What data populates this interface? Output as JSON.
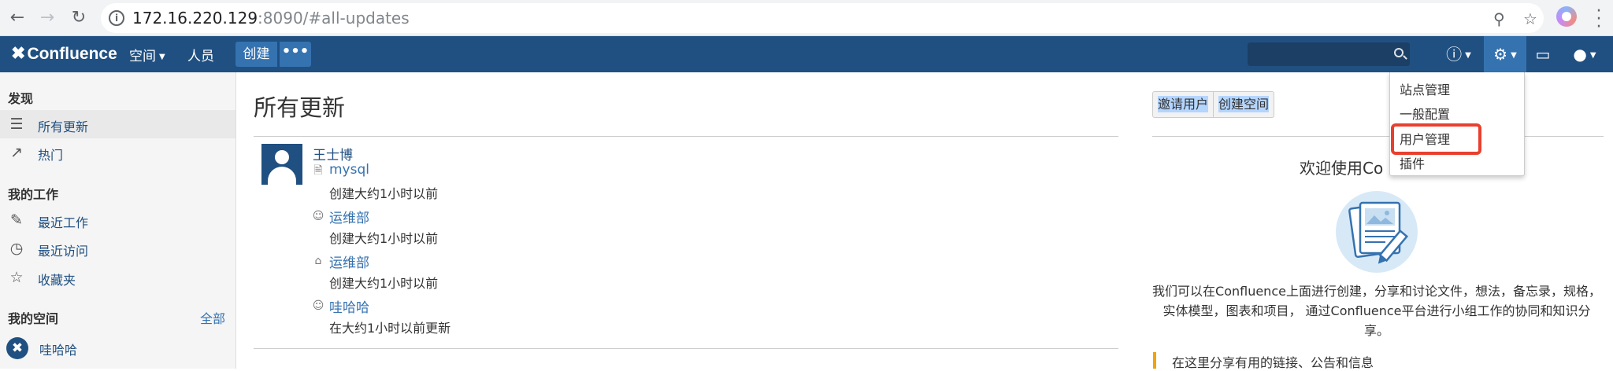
{
  "browser": {
    "back_icon": "arrow-left-icon",
    "forward_icon": "arrow-right-icon",
    "reload_icon": "reload-icon",
    "url_host": "172.16.220.129",
    "url_rest": ":8090/#all-updates"
  },
  "header": {
    "logo": "Confluence",
    "nav_spaces": "空间",
    "nav_people": "人员",
    "create_label": "创建",
    "more_label": "•••",
    "accent": "#205081"
  },
  "sidebar": {
    "discover_heading": "发现",
    "discover_items": [
      {
        "label": "所有更新",
        "icon": "list-icon"
      },
      {
        "label": "热门",
        "icon": "trending-icon"
      }
    ],
    "work_heading": "我的工作",
    "work_items": [
      {
        "label": "最近工作",
        "icon": "edit-icon"
      },
      {
        "label": "最近访问",
        "icon": "clock-icon"
      },
      {
        "label": "收藏夹",
        "icon": "star-icon"
      }
    ],
    "spaces_heading": "我的空间",
    "spaces_all": "全部",
    "spaces": [
      {
        "label": "哇哈哈"
      }
    ]
  },
  "main": {
    "title": "所有更新",
    "author": "王士博",
    "updates": [
      {
        "icon": "page-icon",
        "title": "mysql",
        "meta": "创建大约1小时以前"
      },
      {
        "icon": "space-icon",
        "title": "运维部",
        "meta": "创建大约1小时以前"
      },
      {
        "icon": "home-page-icon",
        "title": "运维部",
        "meta": "创建大约1小时以前"
      },
      {
        "icon": "space-icon",
        "title": "哇哈哈",
        "meta": "在大约1小时以前更新"
      }
    ]
  },
  "right": {
    "invite_users": "邀请用户",
    "create_space": "创建空间",
    "welcome_title": "欢迎使用Co",
    "welcome_text": "我们可以在Confluence上面进行创建，分享和讨论文件，想法，备忘录，规格，实体模型，图表和项目， 通过Confluence平台进行小组工作的协同和知识分享。",
    "tip": "在这里分享有用的链接、公告和信息"
  },
  "admin_menu": {
    "items": [
      "站点管理",
      "一般配置",
      "用户管理",
      "插件"
    ],
    "highlight_color": "#e8402f"
  }
}
